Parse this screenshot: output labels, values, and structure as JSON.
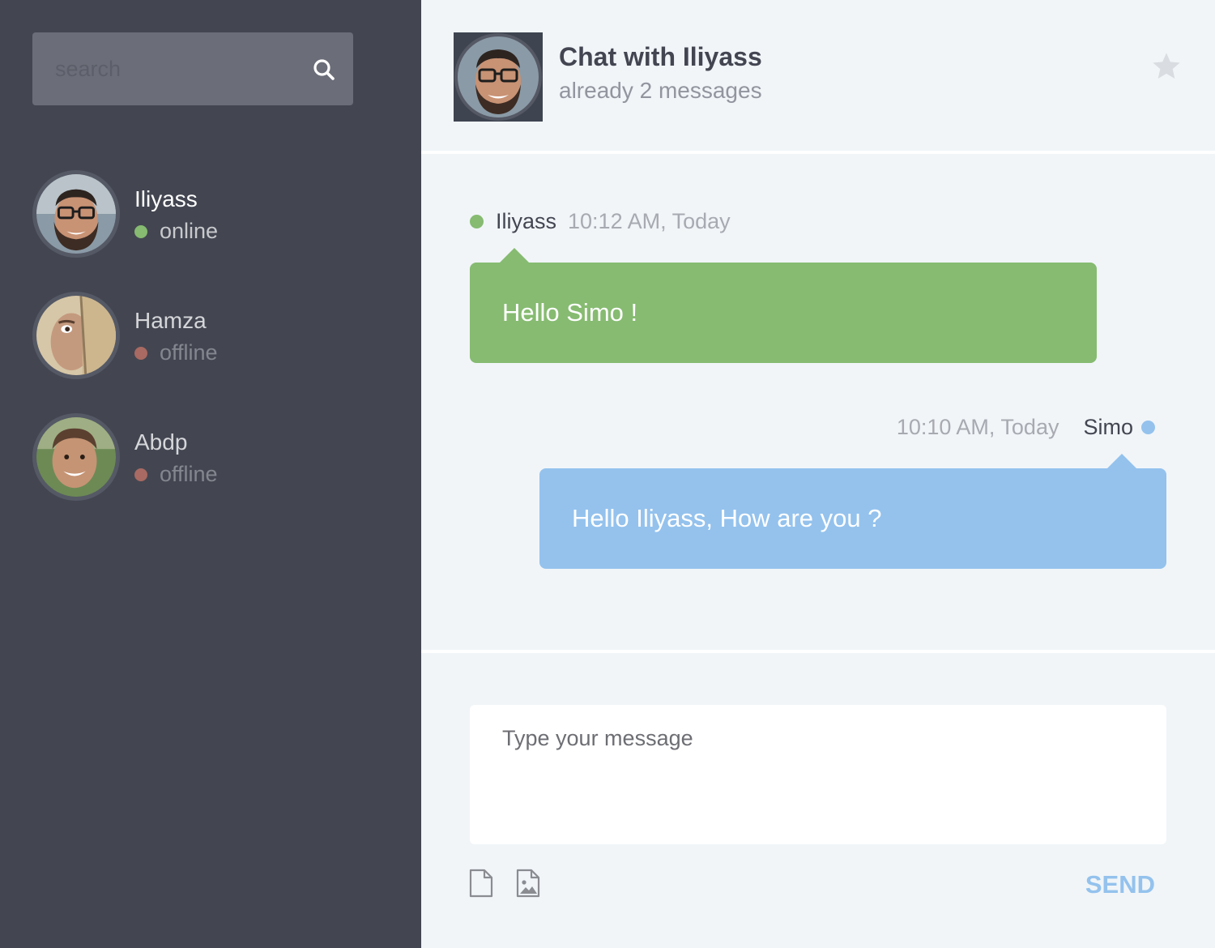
{
  "search": {
    "placeholder": "search"
  },
  "contacts": [
    {
      "name": "Iliyass",
      "status": "online",
      "status_color": "#86bb71"
    },
    {
      "name": "Hamza",
      "status": "offline",
      "status_color": "#a86a62"
    },
    {
      "name": "Abdp",
      "status": "offline",
      "status_color": "#a86a62"
    }
  ],
  "header": {
    "title": "Chat with Iliyass",
    "subtitle": "already 2 messages"
  },
  "messages": [
    {
      "author": "Iliyass",
      "time": "10:12 AM, Today",
      "text": "Hello Simo !",
      "color": "#86bb71"
    },
    {
      "author": "Simo",
      "time": "10:10 AM, Today",
      "text": "Hello Iliyass, How are you ?",
      "color": "#94c2ed"
    }
  ],
  "composer": {
    "placeholder": "Type your message",
    "send_label": "SEND"
  },
  "colors": {
    "sidebar_bg": "#434651",
    "chat_bg": "#f1f5f8",
    "accent_blue": "#94c2ed",
    "accent_green": "#86bb71"
  }
}
